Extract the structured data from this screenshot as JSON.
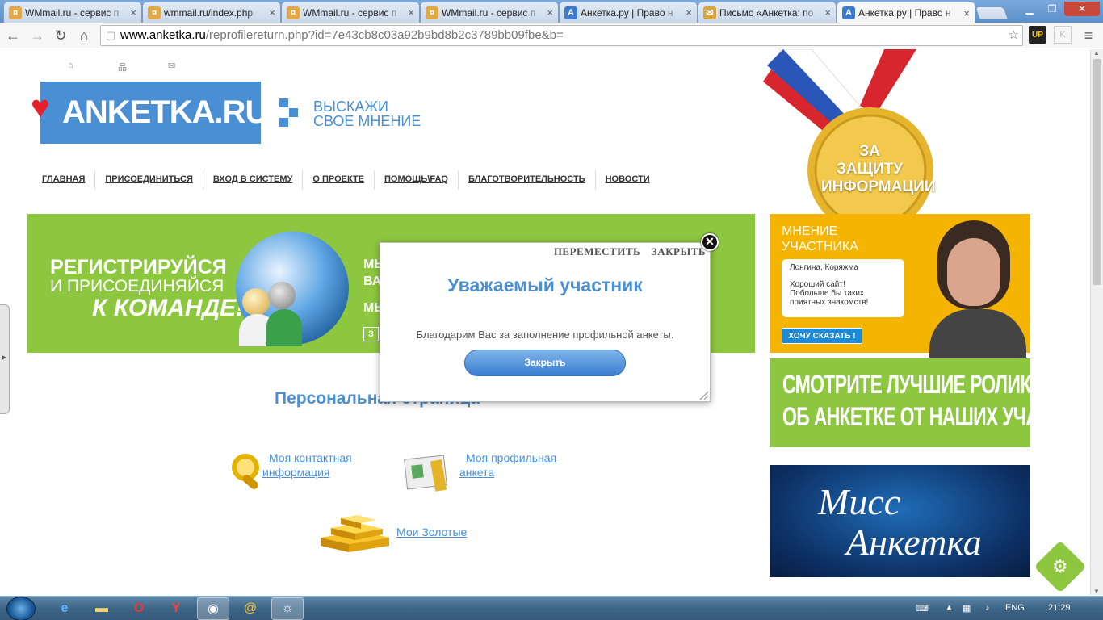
{
  "browser": {
    "tabs": [
      {
        "title": "WMmail.ru - сервис п",
        "icon": "coin-favicon-icon",
        "active": false
      },
      {
        "title": "wmmail.ru/index.php",
        "icon": "coin-favicon-icon",
        "active": false
      },
      {
        "title": "WMmail.ru - сервис п",
        "icon": "coin-favicon-icon",
        "active": false
      },
      {
        "title": "WMmail.ru - сервис п",
        "icon": "coin-favicon-icon",
        "active": false
      },
      {
        "title": "Анкетка.ру | Право н",
        "icon": "anketka-favicon-icon",
        "active": false
      },
      {
        "title": "Письмо «Анкетка: по",
        "icon": "mail-favicon-icon",
        "active": false
      },
      {
        "title": "Анкетка.ру | Право н",
        "icon": "anketka-favicon-icon",
        "active": true
      }
    ],
    "url_host": "www.anketka.ru",
    "url_path": "/reprofilereturn.php?id=7e43cb8c03a92b9bd8b2c3789bb09fbe&b="
  },
  "site": {
    "logo_text": "ANKETKA.RU",
    "slogan_line1": "ВЫСКАЖИ",
    "slogan_line2": "СВОЕ МНЕНИЕ",
    "nav": [
      "ГЛАВНАЯ",
      "ПРИСОЕДИНИТЬСЯ",
      "ВХОД В СИСТЕМУ",
      "О ПРОЕКТЕ",
      "ПОМОЩЬ\\FAQ",
      "БЛАГОТВОРИТЕЛЬНОСТЬ",
      "НОВОСТИ"
    ],
    "medal_line1": "ЗА",
    "medal_line2": "ЗАЩИТУ",
    "medal_line3": "ИНФОРМАЦИИ"
  },
  "banner": {
    "line1": "РЕГИСТРИРУЙСЯ",
    "line2": "И ПРИСОЕДИНЯЙСЯ",
    "line3": "К КОМАНДЕ!",
    "side1": "МЫ",
    "side2": "ВА",
    "side3": "МЫ",
    "side4": "З"
  },
  "review": {
    "heading1": "МНЕНИЕ",
    "heading2": "УЧАСТНИКА",
    "author": "Лонгина, Коряжма",
    "text1": "Хороший сайт!",
    "text2": "Побольше бы таких",
    "text3": "приятных знакомств!",
    "button": "ХОЧУ СКАЗАТЬ !"
  },
  "videos": {
    "line1": "СМОТРИТЕ ЛУЧШИЕ РОЛИКИ",
    "line2": "ОБ АНКЕТКЕ ОТ НАШИХ УЧАСТНИКОВ!"
  },
  "miss": {
    "line1": "Мисс",
    "line2": "Анкетка"
  },
  "personal": {
    "title": "Персональная страница",
    "contact_line1": "Моя контактная",
    "contact_line2": "информация",
    "profile_line1": "Моя профильная",
    "profile_line2": "анкета",
    "gold": "Мои Золотые"
  },
  "modal": {
    "move": "ПЕРЕМЕСТИТЬ",
    "close_link": "ЗАКРЫТЬ",
    "title": "Уважаемый участник",
    "message": "Благодарим Вас за заполнение профильной анкеты.",
    "button": "Закрыть"
  },
  "taskbar": {
    "lang": "ENG",
    "time": "21:29"
  }
}
